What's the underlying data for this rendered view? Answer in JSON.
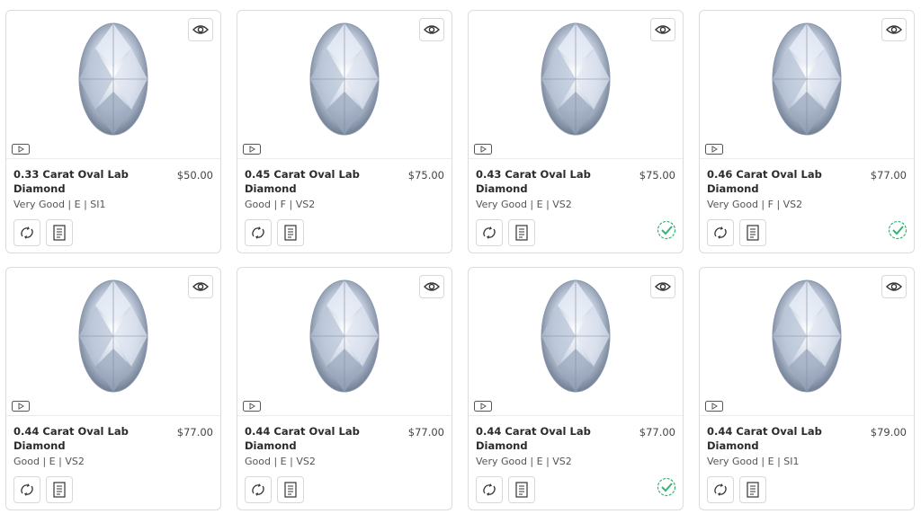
{
  "accent_color": "#3bb273",
  "cards": [
    {
      "title": "0.33 Carat Oval Lab Diamond",
      "price": "$50.00",
      "specs": "Very Good | E | SI1",
      "verified": false
    },
    {
      "title": "0.45 Carat Oval Lab Diamond",
      "price": "$75.00",
      "specs": "Good | F | VS2",
      "verified": false
    },
    {
      "title": "0.43 Carat Oval Lab Diamond",
      "price": "$75.00",
      "specs": "Very Good | E | VS2",
      "verified": true
    },
    {
      "title": "0.46 Carat Oval Lab Diamond",
      "price": "$77.00",
      "specs": "Very Good | F | VS2",
      "verified": true
    },
    {
      "title": "0.44 Carat Oval Lab Diamond",
      "price": "$77.00",
      "specs": "Good | E | VS2",
      "verified": false
    },
    {
      "title": "0.44 Carat Oval Lab Diamond",
      "price": "$77.00",
      "specs": "Good | E | VS2",
      "verified": false
    },
    {
      "title": "0.44 Carat Oval Lab Diamond",
      "price": "$77.00",
      "specs": "Very Good | E | VS2",
      "verified": true
    },
    {
      "title": "0.44 Carat Oval Lab Diamond",
      "price": "$79.00",
      "specs": "Very Good | E | SI1",
      "verified": false
    }
  ],
  "icons": {
    "quick_view": "eye-icon",
    "video": "video-play-icon",
    "compare": "compare-icon",
    "certificate": "certificate-icon",
    "verified": "verified-check-icon"
  }
}
